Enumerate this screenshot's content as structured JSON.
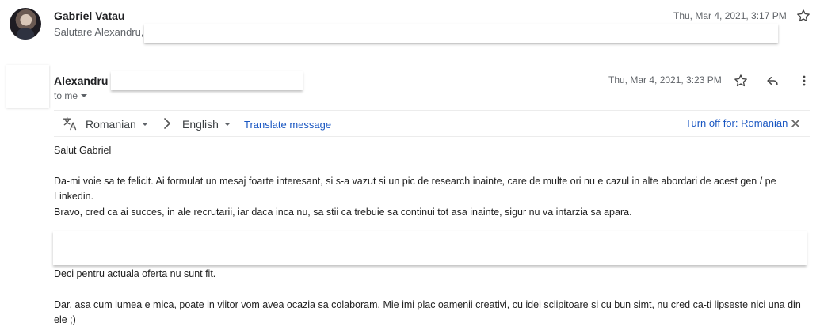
{
  "message1": {
    "sender": "Gabriel Vatau",
    "snippet": "Salutare Alexandru,",
    "date": "Thu, Mar 4, 2021, 3:17 PM"
  },
  "message2": {
    "sender": "Alexandru",
    "recipient": "to me",
    "date": "Thu, Mar 4, 2021, 3:23 PM"
  },
  "translate_bar": {
    "source_language": "Romanian",
    "target_language": "English",
    "translate_link": "Translate message",
    "turn_off_link": "Turn off for: Romanian"
  },
  "body": {
    "greeting": "Salut Gabriel",
    "paragraph1": "Da-mi voie sa te felicit. Ai formulat un mesaj foarte interesant, si s-a vazut si un pic de research inainte, care de multe ori nu e cazul in alte abordari de acest gen / pe Linkedin.",
    "paragraph2": "Bravo, cred ca ai succes, in ale recrutarii, iar daca inca nu, sa stii ca trebuie sa continui tot asa inainte, sigur nu va intarzia sa apara.",
    "paragraph3": "Deci pentru actuala oferta nu sunt fit.",
    "paragraph4": "Dar, asa cum lumea e mica, poate in viitor vom avea ocazia sa colaboram. Mie imi plac oamenii creativi, cu idei sclipitoare si cu bun simt, nu cred ca-ti lipseste nici una din ele ;)"
  },
  "colors": {
    "link": "#1a57c2",
    "secondary_text": "#5f6368"
  }
}
